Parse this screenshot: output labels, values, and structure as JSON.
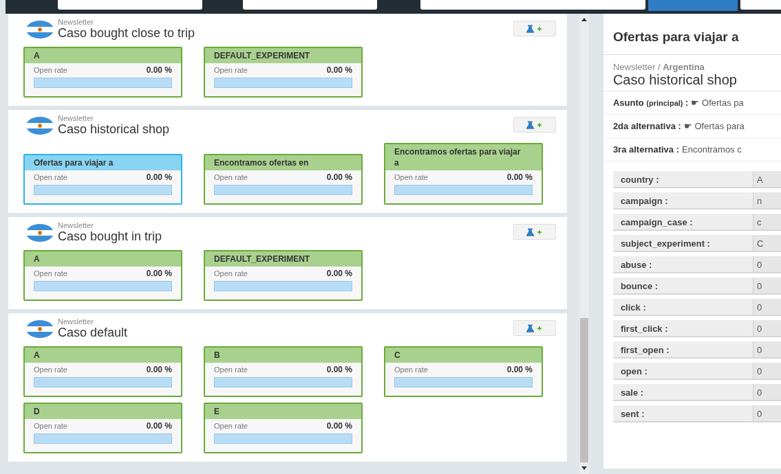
{
  "cases": [
    {
      "category": "Newsletter",
      "title": "Caso bought close to trip",
      "variants": [
        {
          "name": "A",
          "selected": false,
          "metric": "Open rate",
          "value": "0.00 %",
          "level": 0
        },
        {
          "name": "DEFAULT_EXPERIMENT",
          "selected": false,
          "metric": "Open rate",
          "value": "0.00 %",
          "level": 0
        }
      ]
    },
    {
      "category": "Newsletter",
      "title": "Caso historical shop",
      "variants": [
        {
          "name": "Ofertas para viajar a",
          "selected": true,
          "metric": "Open rate",
          "value": "0.00 %",
          "level": 0
        },
        {
          "name": "Encontramos ofertas en",
          "selected": false,
          "metric": "Open rate",
          "value": "0.00 %",
          "level": 0
        },
        {
          "name": "Encontramos ofertas para viajar a",
          "selected": false,
          "metric": "Open rate",
          "value": "0.00 %",
          "level": 0
        }
      ]
    },
    {
      "category": "Newsletter",
      "title": "Caso bought in trip",
      "variants": [
        {
          "name": "A",
          "selected": false,
          "metric": "Open rate",
          "value": "0.00 %",
          "level": 0
        },
        {
          "name": "DEFAULT_EXPERIMENT",
          "selected": false,
          "metric": "Open rate",
          "value": "0.00 %",
          "level": 0
        }
      ]
    },
    {
      "category": "Newsletter",
      "title": "Caso default",
      "variants": [
        {
          "name": "A",
          "selected": false,
          "metric": "Open rate",
          "value": "0.00 %",
          "level": 0
        },
        {
          "name": "B",
          "selected": false,
          "metric": "Open rate",
          "value": "0.00 %",
          "level": 0
        },
        {
          "name": "C",
          "selected": false,
          "metric": "Open rate",
          "value": "0.00 %",
          "level": 0
        },
        {
          "name": "D",
          "selected": false,
          "metric": "Open rate",
          "value": "0.00 %",
          "level": 0
        },
        {
          "name": "E",
          "selected": false,
          "metric": "Open rate",
          "value": "0.00 %",
          "level": 0
        }
      ]
    }
  ],
  "detail": {
    "title": "Ofertas para viajar a",
    "breadcrumb": "Newsletter / **Argentina**",
    "case_title": "Caso historical shop",
    "subjects": [
      {
        "label": "Asunto",
        "note": "(principal)",
        "sep": ":",
        "value": "☛ Ofertas pa"
      },
      {
        "label": "2da alternativa",
        "sep": ":",
        "value": "☛ Ofertas para"
      },
      {
        "label": "3ra alternativa",
        "sep": ":",
        "value": "Encontramos c"
      }
    ],
    "fields": [
      {
        "label": "country :",
        "value": "A"
      },
      {
        "label": "campaign :",
        "value": "n"
      },
      {
        "label": "campaign_case :",
        "value": "c"
      },
      {
        "label": "subject_experiment :",
        "value": "C"
      },
      {
        "label": "abuse :",
        "value": "0"
      },
      {
        "label": "bounce :",
        "value": "0"
      },
      {
        "label": "click :",
        "value": "0"
      },
      {
        "label": "first_click :",
        "value": "0"
      },
      {
        "label": "first_open :",
        "value": "0"
      },
      {
        "label": "open :",
        "value": "0"
      },
      {
        "label": "sale :",
        "value": "0"
      },
      {
        "label": "sent :",
        "value": "0"
      }
    ]
  }
}
